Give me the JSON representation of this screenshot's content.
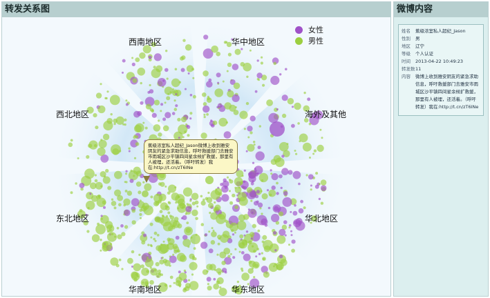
{
  "left_panel": {
    "title": "转发关系图"
  },
  "right_panel": {
    "title": "微博内容"
  },
  "legend": [
    {
      "label": "女性",
      "color": "#a052c8"
    },
    {
      "label": "男性",
      "color": "#9ccf40"
    }
  ],
  "regions": [
    "西南地区",
    "华中地区",
    "海外及其他",
    "华北地区",
    "华东地区",
    "华南地区",
    "东北地区",
    "西北地区"
  ],
  "tooltip": {
    "text": "蕉级浓室私人超纪_Jason微博上收到雅安阴友的紧急求助信息，呼吁救援部门去雅安市雨城区沙平镇四间星余候扩救援，那里有人被埋，还活着。（呼吁转发）我在:http://t.cn/zT6INe"
  },
  "weibo": {
    "name_label": "姓名",
    "name": "蕉级浓室私人超纪_Jason",
    "gender_label": "性别",
    "gender": "男",
    "region_label": "地区",
    "region": "辽宁",
    "type_label": "等级",
    "type": "个人认证",
    "time_label": "时间",
    "time": "2013-04-22 10:49:23",
    "repost_label": "转发数",
    "repost": "11",
    "content_label": "内容",
    "content": "微博上收到雅安阴友的紧急求助信息，呼吁救援部门去雅安市雨城区沙平镇四间星余候扩救援，那里有人被埋，还活着。（呼吁转发）我在:http://t.cn/zT6INe"
  },
  "colors": {
    "female": "#a052c8",
    "male": "#9ccf40",
    "header": "#b7cfcf",
    "panel_bg": "#f3f9fd"
  }
}
